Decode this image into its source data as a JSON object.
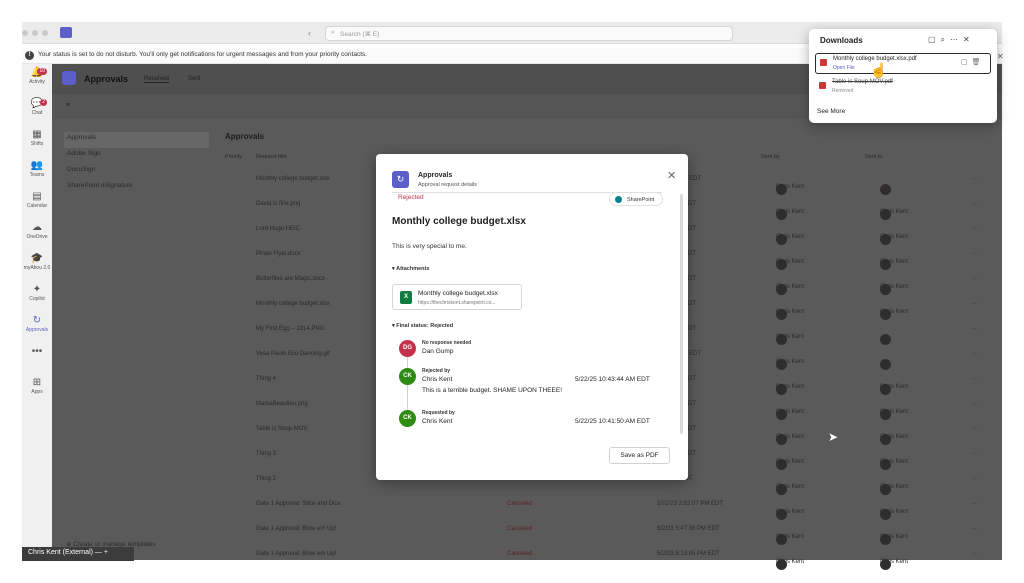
{
  "window": {
    "search_placeholder": "Search (⌘ E)",
    "nav": "‹  ›"
  },
  "banner": {
    "text": "Your status is set to do not disturb. You'll only get notifications for urgent messages and from your priority contacts."
  },
  "rail": [
    {
      "label": "Activity",
      "icon": "bell-icon",
      "glyph": "🔔",
      "badge": "10"
    },
    {
      "label": "Chat",
      "icon": "chat-icon",
      "glyph": "💬",
      "badge": "2"
    },
    {
      "label": "Shifts",
      "icon": "shifts-icon",
      "glyph": "▦",
      "badge": ""
    },
    {
      "label": "Teams",
      "icon": "teams-icon",
      "glyph": "👥",
      "badge": ""
    },
    {
      "label": "Calendar",
      "icon": "calendar-icon",
      "glyph": "▤",
      "badge": ""
    },
    {
      "label": "OneDrive",
      "icon": "cloud-icon",
      "glyph": "☁",
      "badge": ""
    },
    {
      "label": "myAbou 2.0",
      "icon": "hat-icon",
      "glyph": "🎓",
      "badge": ""
    },
    {
      "label": "Copilot",
      "icon": "copilot-icon",
      "glyph": "✦",
      "badge": ""
    },
    {
      "label": "Approvals",
      "icon": "approvals-icon",
      "glyph": "↻",
      "badge": ""
    },
    {
      "label": "",
      "icon": "more-icon",
      "glyph": "•••",
      "badge": ""
    },
    {
      "label": "Apps",
      "icon": "apps-icon",
      "glyph": "⊞",
      "badge": ""
    }
  ],
  "app": {
    "title": "Approvals",
    "tabs": [
      "Received",
      "Sent"
    ],
    "leftnav": [
      "Approvals",
      "Adobe Sign",
      "DocuSign",
      "SharePoint eSignature"
    ],
    "create_templates": "Create or manage templates",
    "section_title": "Approvals",
    "columns": {
      "priority": "Priority",
      "title": "Request title",
      "sent_by": "Sent by",
      "sent_to": "Sent to"
    }
  },
  "rows": [
    {
      "title": "Monthly college budget.xlsx",
      "status": "",
      "date": "0:41:50 AM EDT",
      "by": "Chris Kent",
      "to": ""
    },
    {
      "title": "David is fine.png",
      "status": "",
      "date": "45:38 AM EDT",
      "by": "Chris Kent",
      "to": "Chris Kent"
    },
    {
      "title": "Lord Hugo.HEIC",
      "status": "",
      "date": "16:24 AM EDT",
      "by": "Chris Kent",
      "to": "Chris Kent"
    },
    {
      "title": "Pirate Flyer.docx",
      "status": "",
      "date": "14:37 AM EDT",
      "by": "Chris Kent",
      "to": "Chris Kent"
    },
    {
      "title": "Butterflies are Magic.docx",
      "status": "",
      "date": "45:47 AM EDT",
      "by": "Chris Kent",
      "to": "Chris Kent"
    },
    {
      "title": "Monthly college budget.xlsx",
      "status": "",
      "date": "42:15 AM EDT",
      "by": "Chris Kent",
      "to": "Chris Kent"
    },
    {
      "title": "My First Egg – 1914.PNG",
      "status": "",
      "date": "30:46 AM EDT",
      "by": "Chris Kent",
      "to": ""
    },
    {
      "title": "Vesa Paulo Elio Dancing.gif",
      "status": "",
      "date": "3:16:13 AM EDT",
      "by": "Chris Kent",
      "to": ""
    },
    {
      "title": "Thing 4",
      "status": "",
      "date": "33:38 AM EDT",
      "by": "Chris Kent",
      "to": "Chris Kent"
    },
    {
      "title": "MamaBeaulieu.png",
      "status": "",
      "date": "32:50 AM EDT",
      "by": "Chris Kent",
      "to": "Chris Kent"
    },
    {
      "title": "Table is Soup.MOV",
      "status": "",
      "date": "32:14 AM EDT",
      "by": "Chris Kent",
      "to": "Chris Kent"
    },
    {
      "title": "Thing 3",
      "status": "",
      "date": "23:39 AM EDT",
      "by": "Chris Kent",
      "to": "Chris Kent"
    },
    {
      "title": "Thing 2",
      "status": "",
      "date": "1:47 AM EDT",
      "by": "Chris Kent",
      "to": "Chris Kent"
    },
    {
      "title": "Gate 1 Approval: Slice and Dice",
      "status": "Canceled",
      "date": "10/1/23 2:52:07 PM EDT",
      "by": "Chris Kent",
      "to": "Chris Kent"
    },
    {
      "title": "Gate 1 Approval: Blow em Up!",
      "status": "Canceled",
      "date": "5/2/23 5:47:36 PM EDT",
      "by": "Chris Kent",
      "to": "Chris Kent"
    },
    {
      "title": "Gate 1 Approval: Blow em Up!",
      "status": "Canceled",
      "date": "5/2/23 5:13:05 PM EDT",
      "by": "Chris Kent",
      "to": "Chris Kent"
    }
  ],
  "status_bar": {
    "text": "Chris Kent (External)  —  +"
  },
  "modal": {
    "app_name": "Approvals",
    "subtitle": "Approval request details",
    "status": "Rejected",
    "source": "SharePoint",
    "heading": "Monthly college budget.xlsx",
    "description": "This is very special to me.",
    "attachments_label": "Attachments",
    "attachment": {
      "name": "Monthly college budget.xlsx",
      "url": "https://thechriskent.sharepoint.co...",
      "badge": "X"
    },
    "final_status_label": "Final status: Rejected",
    "timeline": [
      {
        "initials": "DG",
        "color": "#c4314b",
        "label": "No response needed",
        "name": "Dan Gump",
        "date": "",
        "comment": ""
      },
      {
        "initials": "CK",
        "color": "#2e8b14",
        "label": "Rejected by",
        "name": "Chris Kent",
        "date": "5/22/25 10:43:44 AM EDT",
        "comment": "This is a terrible budget. SHAME UPON THEEE!"
      },
      {
        "initials": "CK",
        "color": "#2e8b14",
        "label": "Requested by",
        "name": "Chris Kent",
        "date": "5/22/25 10:41:50 AM EDT",
        "comment": ""
      }
    ],
    "save_pdf": "Save as PDF"
  },
  "downloads": {
    "title": "Downloads",
    "items": [
      {
        "name": "Monthly college budget.xlsx.pdf",
        "sub": "Open File",
        "removed": false
      },
      {
        "name": "Table is Soup.MOV.pdf",
        "sub": "Removed",
        "removed": true
      }
    ],
    "see_more": "See More"
  }
}
